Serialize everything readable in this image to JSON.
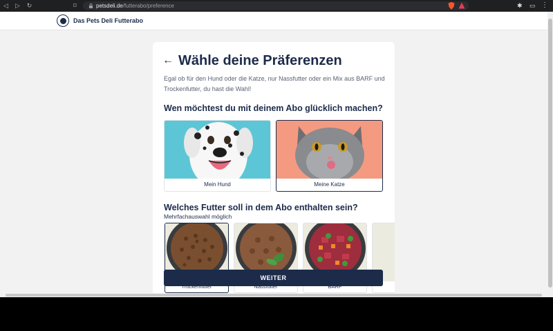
{
  "browser": {
    "url_host": "petsdeli.de",
    "url_path": "/futterabo/preference"
  },
  "header": {
    "brand": "Das Pets Deli Futterabo"
  },
  "page": {
    "title": "Wähle deine Präferenzen",
    "intro": "Egal ob für den Hund oder die Katze, nur Nassfutter oder ein Mix aus BARF und Trockenfutter, du hast die Wahl!",
    "question_pet": "Wen möchtest du mit deinem Abo glücklich machen?",
    "pets": [
      {
        "label": "Mein Hund",
        "selected": false,
        "bg": "#5cc6d6"
      },
      {
        "label": "Meine Katze",
        "selected": true,
        "bg": "#f49a80"
      }
    ],
    "question_food": "Welches Futter soll in dem Abo enthalten sein?",
    "hint": "Mehrfachauswahl möglich",
    "foods": [
      {
        "label": "Trockenfutter",
        "selected": true
      },
      {
        "label": "Nassfutter",
        "selected": false
      },
      {
        "label": "BARF",
        "selected": false
      },
      {
        "label": "",
        "selected": false
      }
    ],
    "cta": "WEITER"
  }
}
